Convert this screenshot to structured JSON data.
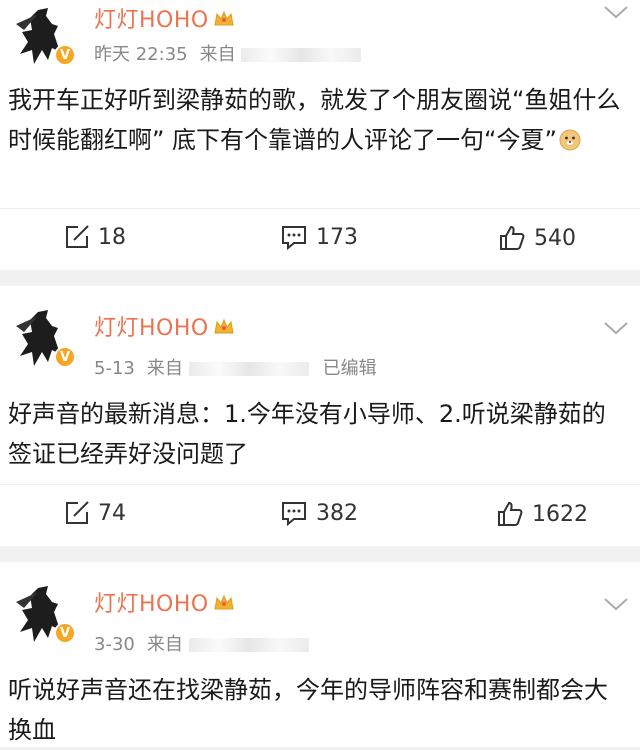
{
  "posts": [
    {
      "username": "灯灯HOHO",
      "verified_badge": "V",
      "time": "昨天 22:35",
      "source_prefix": "来自",
      "edited": "",
      "text": "我开车正好听到梁静茹的歌，就发了个朋友圈说“鱼姐什么时候能翻红啊” 底下有个靠谱的人评论了一句“今夏”",
      "emoji": "doge-emoji",
      "reposts": "18",
      "comments": "173",
      "likes": "540"
    },
    {
      "username": "灯灯HOHO",
      "verified_badge": "V",
      "time": "5-13",
      "source_prefix": "来自",
      "edited": "已编辑",
      "text": "好声音的最新消息：1.今年没有小导师、2.听说梁静茹的签证已经弄好没问题了",
      "reposts": "74",
      "comments": "382",
      "likes": "1622"
    },
    {
      "username": "灯灯HOHO",
      "verified_badge": "V",
      "time": "3-30",
      "source_prefix": "来自",
      "edited": "",
      "text": "听说好声音还在找梁静茹，今年的导师阵容和赛制都会大换血"
    }
  ],
  "icons": {
    "repost": "repost-icon",
    "comment": "comment-icon",
    "like": "thumbs-up-icon",
    "crown": "crown-icon",
    "chevron": "chevron-down-icon"
  },
  "colors": {
    "username": "#eb7350",
    "verified": "#f5a623",
    "meta": "#888888",
    "separator": "#f1f1f1"
  }
}
